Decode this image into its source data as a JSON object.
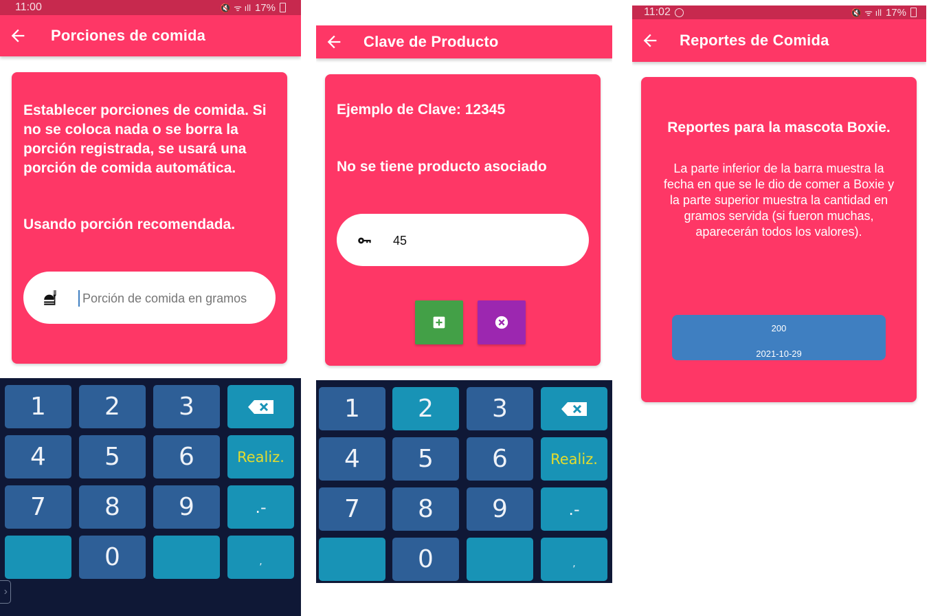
{
  "panel1": {
    "status": {
      "time": "11:00",
      "battery": "17%"
    },
    "appbar_title": "Porciones de comida",
    "card_text": "Establecer porciones de comida. Si no se coloca nada o se borra la porción registrada, se usará una porción de comida automática.",
    "status_text": "Usando porción recomendada.",
    "input": {
      "placeholder": "Porción de comida en gramos",
      "value": ""
    },
    "icon": "food-portion-icon"
  },
  "panel2": {
    "appbar_title": "Clave de Producto",
    "example_text": "Ejemplo de Clave: 12345",
    "status_text": "No se tiene producto asociado",
    "input": {
      "value": "45"
    },
    "icon": "key-icon",
    "buttons": {
      "add_color": "#43a047",
      "cancel_color": "#9c27b0"
    }
  },
  "panel3": {
    "status": {
      "time": "11:02",
      "battery": "17%"
    },
    "appbar_title": "Reportes de Comida",
    "heading": "Reportes para la mascota Boxie.",
    "description": "La parte inferior de la barra muestra la fecha en que se le dio de comer a Boxie y la parte superior muestra la cantidad en gramos servida (si fueron muchas, aparecerán todos los valores).",
    "report": {
      "amount": "200",
      "date": "2021-10-29"
    }
  },
  "keyboard": {
    "rows": [
      [
        "1",
        "2",
        "3",
        "⌫"
      ],
      [
        "4",
        "5",
        "6",
        "Realiz."
      ],
      [
        "7",
        "8",
        "9",
        ".-"
      ],
      [
        "",
        "0",
        "",
        ","
      ]
    ]
  },
  "colors": {
    "primary": "#fe3766",
    "statusbar": "#c7294e",
    "keyboard_bg": "#0f1836",
    "key_number": "#2e5f97",
    "key_function": "#1893b6",
    "report_bar": "#3f7fc1"
  }
}
